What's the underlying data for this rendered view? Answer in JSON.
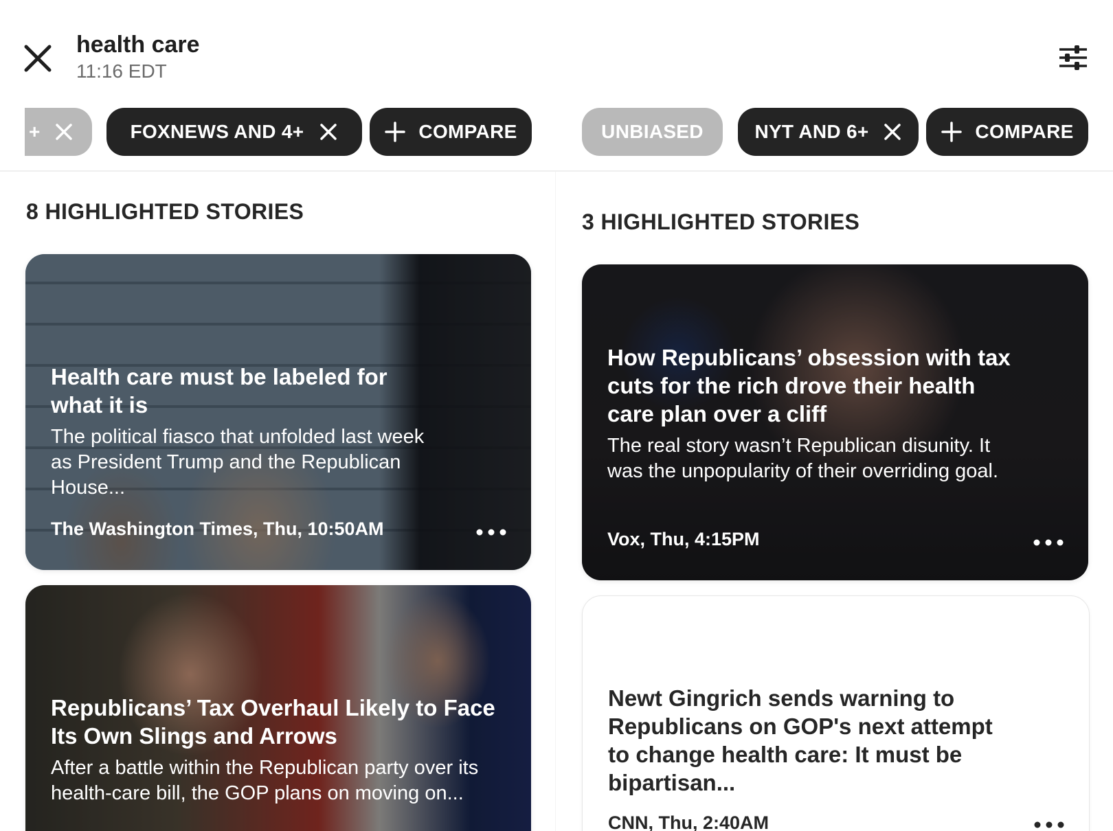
{
  "header": {
    "title": "health care",
    "time": "11:16 EDT"
  },
  "left_column": {
    "chips": {
      "partial_label": "+",
      "source_label": "FOXNEWS AND 4+",
      "compare_label": "COMPARE"
    },
    "heading": "8 HIGHLIGHTED STORIES",
    "stories": [
      {
        "title": "Health care must be labeled for what it is",
        "summary": "The political fiasco that unfolded last week as President Trump and the Republican House...",
        "meta": "The Washington Times, Thu, 10:50AM"
      },
      {
        "title": "Republicans’ Tax Overhaul Likely to Face Its Own Slings and Arrows",
        "summary": "After a battle within the Republican party over its health-care bill, the GOP plans on moving on..."
      }
    ]
  },
  "right_column": {
    "chips": {
      "unbiased_label": "UNBIASED",
      "source_label": "NYT AND 6+",
      "compare_label": "COMPARE"
    },
    "heading": "3 HIGHLIGHTED STORIES",
    "stories": [
      {
        "title": "How Republicans’ obsession with tax cuts for the rich drove their health care plan over a cliff",
        "summary": "The real story wasn’t Republican disunity. It was the unpopularity of their overriding goal.",
        "meta": "Vox, Thu, 4:15PM"
      },
      {
        "title": "Newt Gingrich sends warning to Republicans on GOP's next attempt to change health care: It must be bipartisan...",
        "meta": "CNN, Thu, 2:40AM"
      }
    ]
  },
  "icons": {
    "close": "close-icon",
    "filter": "sliders-icon",
    "chip_remove": "x-icon",
    "chip_add": "plus-icon",
    "more": "ellipsis-icon"
  },
  "colors": {
    "chip_dark": "#242424",
    "chip_gray": "#b9b9b9",
    "text_dark": "#1e1e1e",
    "text_muted": "#6b6b6b"
  }
}
